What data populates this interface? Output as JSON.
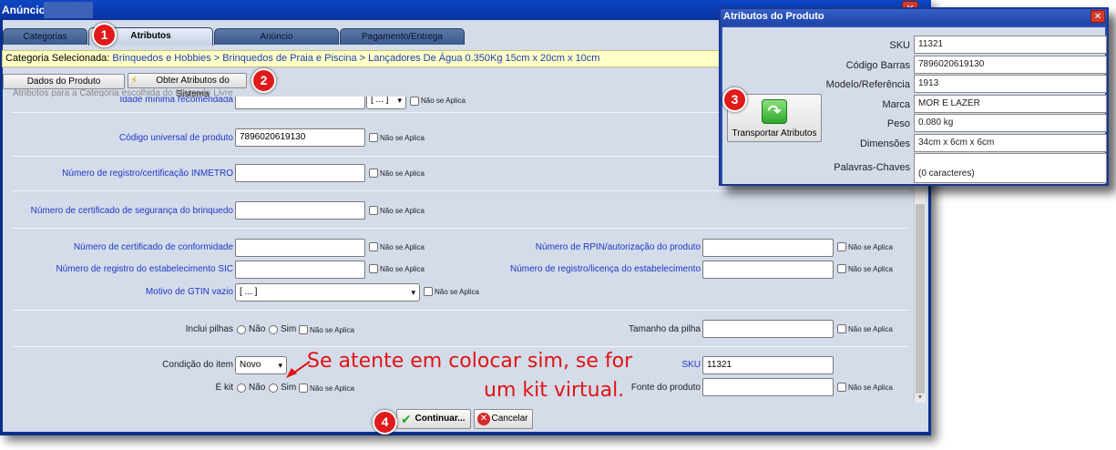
{
  "window": {
    "title": "Anúncio:"
  },
  "tabs": [
    {
      "label": "Categorias"
    },
    {
      "label": "Atributos"
    },
    {
      "label": "Anúncio"
    },
    {
      "label": "Pagamento/Entrega"
    }
  ],
  "category": {
    "prefix": "Categoria Selecionada:",
    "path": "Brinquedos e Hobbies > Brinquedos de Praia e Piscina > Lançadores De Água 0.350Kg 15cm x 20cm x 10cm"
  },
  "toolbar": {
    "dados_label": "Dados do Produto",
    "obter_label": "Obter Atributos do Sistema"
  },
  "subtitle": "Atributos para a Categoria escolhida do Mercado Livre",
  "na_label": "Não se Aplica",
  "form": {
    "idade_label": "Idade mínima recomendada",
    "idade_value": "[ ... ]",
    "codigo_universal_label": "Código universal de produto",
    "codigo_universal_value": "7896020619130",
    "inmetro_label": "Número de registro/certificação INMETRO",
    "seguranca_label": "Número de certificado de segurança do brinquedo",
    "conformidade_label": "Número de certificado de conformidade",
    "rpin_label": "Número de RPIN/autorização do produto",
    "sic_label": "Número de registro do estabelecimento SIC",
    "licenca_label": "Número de registro/licença do estabelecimento",
    "gtin_label": "Motivo de GTIN vazio",
    "gtin_value": "[ ... ]",
    "pilhas_label": "Inclui pilhas",
    "tamanho_pilha_label": "Tamanho da pilha",
    "condicao_label": "Condição do item",
    "condicao_value": "Novo",
    "sku_label": "SKU",
    "sku_value": "11321",
    "kit_label": "É kit",
    "fonte_label": "Fonte do produto",
    "nao_label": "Não",
    "sim_label": "Sim"
  },
  "annotation": {
    "line1": "Se atente em colocar sim, se for",
    "line2": "um kit virtual."
  },
  "buttons": {
    "continuar": "Continuar...",
    "cancelar": "Cancelar"
  },
  "badges": [
    "1",
    "2",
    "3",
    "4"
  ],
  "popup": {
    "title": "Atributos do Produto",
    "sku_label": "SKU",
    "sku_value": "11321",
    "barras_label": "Código Barras",
    "barras_value": "7896020619130",
    "modelo_label": "Modelo/Referência",
    "modelo_value": "1913",
    "marca_label": "Marca",
    "marca_value": "MOR E LAZER",
    "peso_label": "Peso",
    "peso_value": "0.080 kg",
    "dimensoes_label": "Dimensões",
    "dimensoes_value": "34cm x 6cm x 6cm",
    "palavras_label": "Palavras-Chaves",
    "palavras_value": "(0 caracteres)",
    "transport_label": "Transportar Atributos"
  },
  "icons": {
    "bolt": "lightning-icon",
    "ok": "check-icon",
    "cancel": "cancel-icon",
    "transport": "transport-arrow-icon",
    "close": "close-icon"
  },
  "colors": {
    "titlebar": "#0a2f8c",
    "panel": "#d4dcea",
    "category_bar": "#ffffc6",
    "link_blue": "#1f37c4",
    "badge_red": "#e01a1a",
    "annotation_red": "#e01414"
  }
}
